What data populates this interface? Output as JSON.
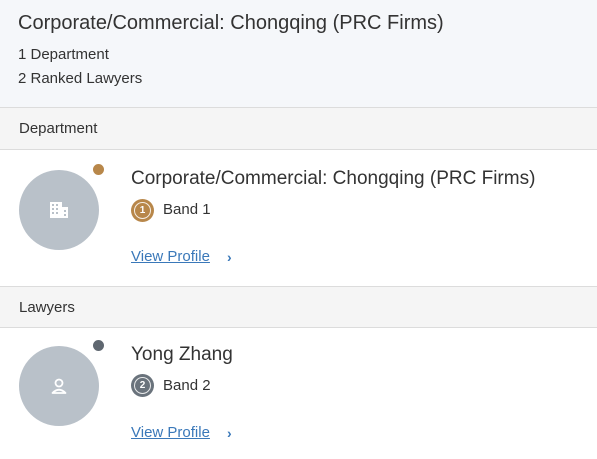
{
  "header": {
    "title": "Corporate/Commercial: Chongqing (PRC Firms)",
    "department_count": "1 Department",
    "lawyer_count": "2 Ranked Lawyers"
  },
  "sections": {
    "department": "Department",
    "lawyers": "Lawyers"
  },
  "department_entry": {
    "name": "Corporate/Commercial: Chongqing (PRC Firms)",
    "band_number": "1",
    "band_label": "Band 1",
    "link_label": "View Profile",
    "icon": "building-icon",
    "medal_color": "#b8874a"
  },
  "lawyer_entry": {
    "name": "Yong Zhang",
    "band_number": "2",
    "band_label": "Band 2",
    "link_label": "View Profile",
    "icon": "person-icon",
    "medal_color": "#5f6770"
  },
  "colors": {
    "link": "#3a78b9",
    "avatar": "#b9c1c9",
    "gold": "#b8874a",
    "grey": "#6a737c"
  }
}
